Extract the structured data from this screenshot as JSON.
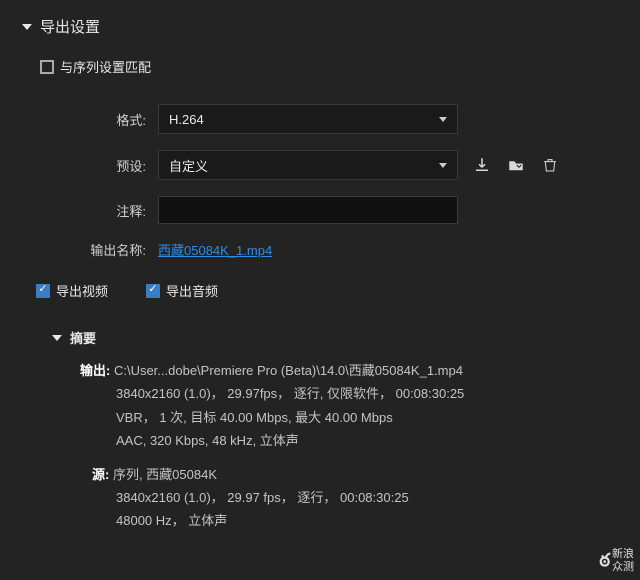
{
  "panel": {
    "title": "导出设置",
    "match_sequence": "与序列设置匹配",
    "format_label": "格式:",
    "format_value": "H.264",
    "preset_label": "预设:",
    "preset_value": "自定义",
    "comment_label": "注释:",
    "comment_value": "",
    "output_name_label": "输出名称:",
    "output_name_value": "西藏05084K_1.mp4",
    "export_video": "导出视频",
    "export_audio": "导出音频"
  },
  "summary": {
    "title": "摘要",
    "output_label": "输出: ",
    "output_path": "C:\\User...dobe\\Premiere Pro (Beta)\\14.0\\西藏05084K_1.mp4",
    "output_line2": "3840x2160 (1.0)， 29.97fps， 逐行, 仅限软件， 00:08:30:25",
    "output_line3": "VBR， 1 次, 目标 40.00 Mbps, 最大 40.00 Mbps",
    "output_line4": "AAC, 320 Kbps, 48 kHz, 立体声",
    "source_label": "源: ",
    "source_line1": "序列, 西藏05084K",
    "source_line2": "3840x2160 (1.0)， 29.97 fps， 逐行， 00:08:30:25",
    "source_line3": "48000 Hz， 立体声"
  },
  "watermark": {
    "brand1": "新浪",
    "brand2": "众测"
  }
}
